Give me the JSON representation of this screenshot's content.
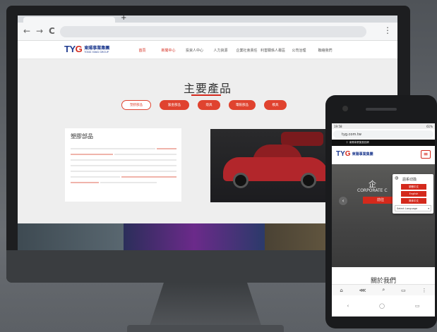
{
  "desktop": {
    "nav_back": "←",
    "nav_forward": "→",
    "nav_reload": "C",
    "new_tab": "+",
    "menu": "⋮",
    "logo": {
      "tyg_part1": "TY",
      "tyg_part2": "G",
      "cn": "東陽事業集團",
      "en": "TONG YANG GROUP"
    },
    "nav_items": [
      {
        "label": "首頁",
        "active": true
      },
      {
        "label": "新聞中心",
        "active": true
      },
      {
        "label": "投資人中心",
        "active": false
      },
      {
        "label": "人力資源",
        "active": false
      },
      {
        "label": "企業社會責任",
        "active": false
      },
      {
        "label": "利害關係人專區",
        "active": false
      },
      {
        "label": "公司治理",
        "active": false
      },
      {
        "label": "聯絡我們",
        "active": false
      }
    ],
    "section_title": "主要產品",
    "pills": [
      "塑膠部品",
      "鈑金部品",
      "燈具",
      "電裝部品",
      "模具"
    ],
    "card_title": "塑膠部品"
  },
  "phone": {
    "status_left": "19:58",
    "status_right": "61%",
    "url": "tyg.com.tw",
    "top_bar": "十 東陽事業集團官網",
    "logo": {
      "tyg_part1": "TY",
      "tyg_part2": "G",
      "cn": "東陽事業集團"
    },
    "hamburger": "≡",
    "hero_big": "企",
    "hero_corp": "CORPORATE C",
    "hero_button": "前往",
    "hero_arrow": "‹",
    "lang_title": "語系切換",
    "lang_buttons": [
      "繁體中文",
      "English",
      "简体中文"
    ],
    "google_select": "Select Language",
    "about_title": "關於我們",
    "nav_icons": [
      "⌂",
      "⋘",
      "⌕",
      "▭",
      "⋮"
    ],
    "home_icons": [
      "‹",
      "◯",
      "▭"
    ]
  },
  "colors": {
    "accent": "#d4291c",
    "brand_blue": "#1f3b8f"
  }
}
